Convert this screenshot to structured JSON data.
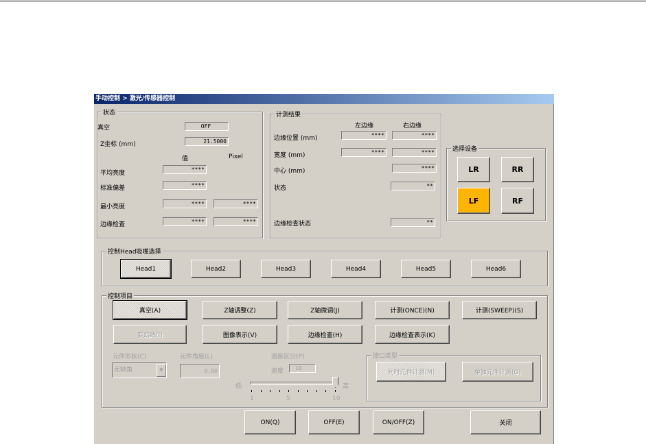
{
  "title": "手动控制 > 激光/传感器控制",
  "status": {
    "label": "状态",
    "vacuum_label": "真空",
    "vacuum_value": "OFF",
    "z_label": "Z坐标 (mm)",
    "z_value": "21.5000",
    "col_value": "值",
    "col_pixel": "Pixel",
    "rows": [
      {
        "label": "平均亮度",
        "value": "****"
      },
      {
        "label": "标准偏差",
        "value": "****"
      },
      {
        "label": "最小亮度",
        "value": "****",
        "pixel": "****"
      },
      {
        "label": "边缘检查",
        "value": "****",
        "pixel": "****"
      }
    ]
  },
  "measure": {
    "label": "计测结果",
    "col_left": "左边缘",
    "col_right": "右边缘",
    "edge_pos_label": "边缘位置 (mm)",
    "edge_pos_left": "****",
    "edge_pos_right": "****",
    "width_label": "宽度 (mm)",
    "width_left": "****",
    "width_right": "****",
    "center_label": "中心 (mm)",
    "center_value": "****",
    "state_label": "状态",
    "state_value": "**",
    "edge_state_label": "边缘检查状态",
    "edge_state_value": "**"
  },
  "device": {
    "label": "选择设备",
    "buttons": [
      "LR",
      "RR",
      "LF",
      "RF"
    ],
    "selected": "LF",
    "selected_color": "#ffb400"
  },
  "head": {
    "label": "控制Head吸嘴选择",
    "buttons": [
      "Head1",
      "Head2",
      "Head3",
      "Head4",
      "Head5",
      "Head6"
    ]
  },
  "control": {
    "label": "控制项目",
    "row1": [
      "真空(A)",
      "Z轴调整(Z)",
      "Z轴微调(J)",
      "计测(ONCE)(N)",
      "计测(SWEEP)(S)"
    ],
    "row2": [
      "变幻线(I)",
      "图像表示(V)",
      "边缘检查(H)",
      "边缘检查表示(K)"
    ],
    "shape_label": "元件形状(C)",
    "shape_value": "无缺角",
    "angle_label": "元件角度(L)",
    "angle_value": "0.00",
    "speed_group_label": "速度区分(P)",
    "speed_label": "速度",
    "speed_value": "10",
    "slider_low": "低",
    "slider_high": "高",
    "slider_ticks": [
      "1",
      "5",
      "10"
    ],
    "slider_value": 10,
    "slider_min": 1,
    "slider_max": 10,
    "interface": {
      "label": "接口类型",
      "buttons": [
        "同时元件计测(M)",
        "单独元件计测(G)"
      ]
    }
  },
  "footer": {
    "on": "ON(Q)",
    "off": "OFF(E)",
    "onoff": "ON/OFF(Z)",
    "close": "关闭"
  }
}
